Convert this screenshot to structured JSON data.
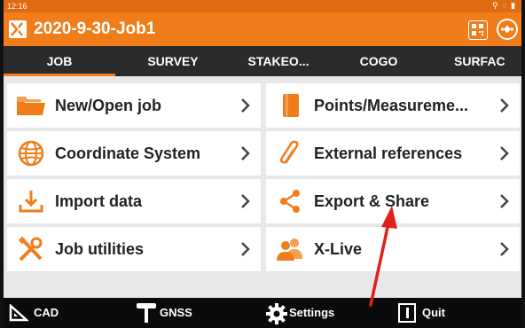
{
  "status_bar": {
    "time": "12:16"
  },
  "title_bar": {
    "job_title": "2020-9-30-Job1"
  },
  "tabs": [
    {
      "label": "JOB",
      "active": true
    },
    {
      "label": "SURVEY"
    },
    {
      "label": "STAKEO..."
    },
    {
      "label": "COGO"
    },
    {
      "label": "SURFAC"
    }
  ],
  "menu": {
    "left": [
      {
        "label": "New/Open job",
        "icon": "folder-icon"
      },
      {
        "label": "Coordinate System",
        "icon": "globe-icon"
      },
      {
        "label": "Import data",
        "icon": "import-icon"
      },
      {
        "label": "Job utilities",
        "icon": "tools-icon"
      }
    ],
    "right": [
      {
        "label": "Points/Measureme...",
        "icon": "points-book-icon"
      },
      {
        "label": "External references",
        "icon": "paperclip-icon"
      },
      {
        "label": "Export & Share",
        "icon": "share-icon"
      },
      {
        "label": "X-Live",
        "icon": "people-icon"
      }
    ]
  },
  "bottom_bar": {
    "cad": "CAD",
    "gnss": "GNSS",
    "settings": "Settings",
    "quit": "Quit"
  },
  "colors": {
    "accent": "#f07d1a",
    "tab_bg": "#2b2b2b",
    "annotation_arrow": "#e0201b"
  }
}
